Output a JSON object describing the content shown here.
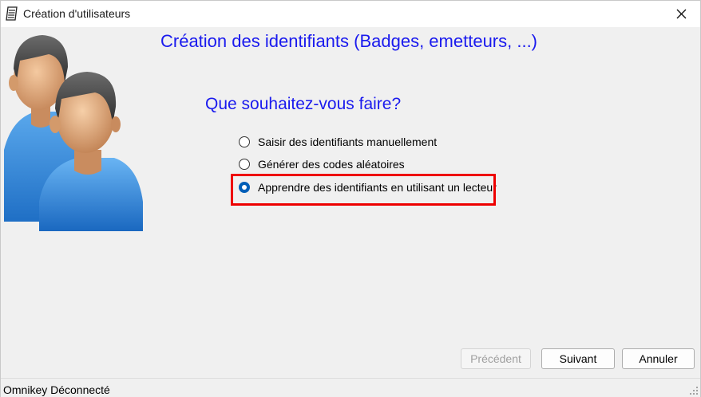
{
  "window": {
    "title": "Création d'utilisateurs",
    "app_icon": "notepad-icon",
    "close_icon": "close-icon"
  },
  "header": {
    "title": "Création des identifiants (Badges, emetteurs, ...)",
    "illustration": "users-icon"
  },
  "question": "Que souhaitez-vous faire?",
  "options": [
    {
      "label": "Saisir des identifiants manuellement",
      "selected": false
    },
    {
      "label": "Générer des codes aléatoires",
      "selected": false
    },
    {
      "label": "Apprendre des identifiants en utilisant un lecteur",
      "selected": true
    }
  ],
  "buttons": {
    "previous": "Précédent",
    "next": "Suivant",
    "cancel": "Annuler"
  },
  "status": {
    "text": "Omnikey Déconnecté"
  },
  "colors": {
    "heading": "#1a1aee",
    "highlight": "#ee0000",
    "radio_selected": "#005fb8"
  }
}
